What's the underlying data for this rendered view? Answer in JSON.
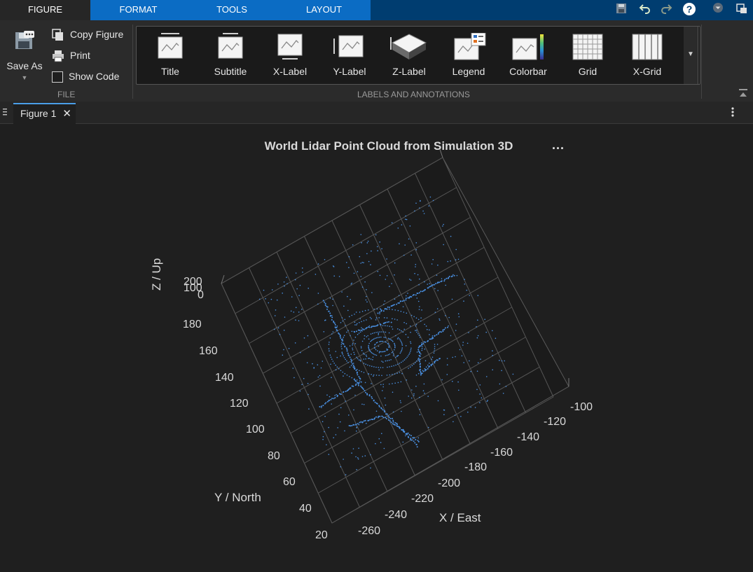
{
  "tabs": [
    {
      "label": "FIGURE",
      "active": true
    },
    {
      "label": "FORMAT",
      "active": false
    },
    {
      "label": "TOOLS",
      "active": false
    },
    {
      "label": "LAYOUT",
      "active": false
    }
  ],
  "quick_access": {
    "save": "save-icon",
    "undo": "undo-icon",
    "redo": "redo-icon",
    "help": "?",
    "menu": "chevron-down-icon",
    "undock": "undock-icon"
  },
  "file_group": {
    "save_as": "Save As",
    "copy_figure": "Copy Figure",
    "print": "Print",
    "show_code": "Show Code",
    "show_code_checked": false,
    "group_label": "FILE"
  },
  "labels_group": {
    "items": [
      "Title",
      "Subtitle",
      "X-Label",
      "Y-Label",
      "Z-Label",
      "Legend",
      "Colorbar",
      "Grid",
      "X-Grid"
    ],
    "group_label": "LABELS AND ANNOTATIONS"
  },
  "document": {
    "tab_label": "Figure 1"
  },
  "plot": {
    "title": "World Lidar Point Cloud from Simulation 3D",
    "xlabel": "X / East",
    "ylabel": "Y / North",
    "zlabel": "Z / Up",
    "xticks": [
      "-260",
      "-240",
      "-220",
      "-200",
      "-180",
      "-160",
      "-140",
      "-120",
      "-100"
    ],
    "yticks": [
      "20",
      "40",
      "60",
      "80",
      "100",
      "120",
      "140",
      "160",
      "180"
    ],
    "zticks": [
      "0",
      "100",
      "200"
    ],
    "point_color": "#4a90e2",
    "axes_toolbar": "..."
  },
  "colors": {
    "accent": "#0b6cc4",
    "titlebar": "#003d70",
    "background": "#1f1f1f"
  }
}
